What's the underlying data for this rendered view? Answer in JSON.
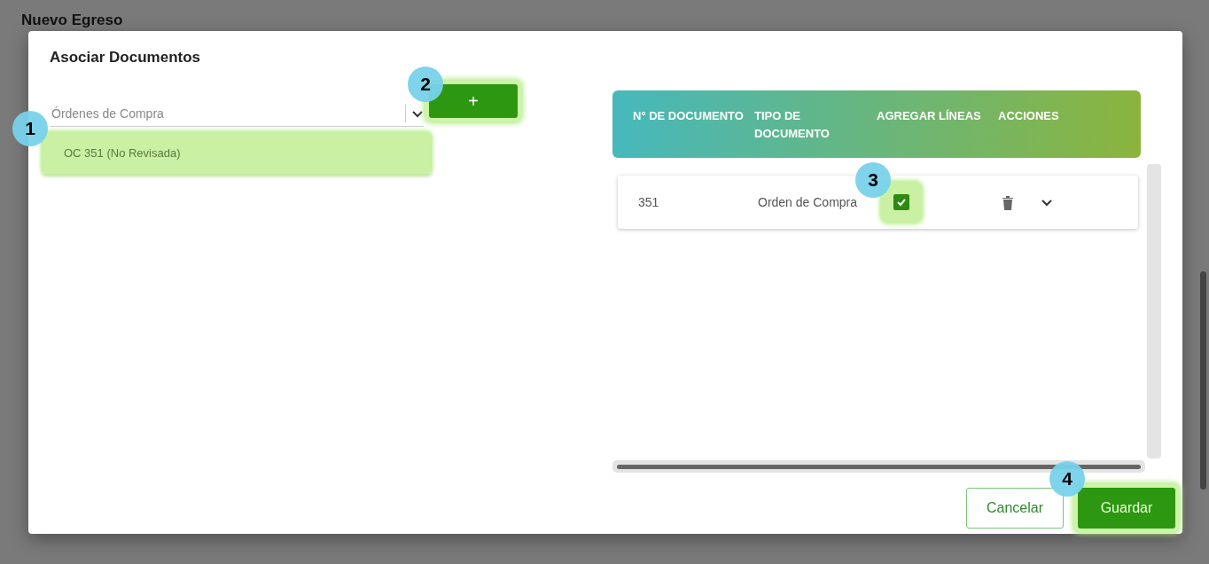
{
  "page": {
    "title": "Nuevo Egreso"
  },
  "dialog": {
    "title": "Asociar Documentos",
    "select": {
      "placeholder": "Órdenes de Compra",
      "options": [
        {
          "label": "OC 351 (No Revisada)",
          "highlighted": true
        }
      ]
    },
    "add_button": {
      "label": "+",
      "highlighted": true
    },
    "table": {
      "columns": [
        "N° DE DOCUMENTO",
        "TIPO DE DOCUMENTO",
        "AGREGAR LÍNEAS",
        "ACCIONES"
      ],
      "rows": [
        {
          "number": "351",
          "type": "Orden de Compra",
          "add_lines": true,
          "highlighted": true
        }
      ]
    },
    "buttons": [
      {
        "label": "Cancelar",
        "kind": "outline",
        "highlighted": false
      },
      {
        "label": "Guardar",
        "kind": "filled",
        "highlighted": true
      }
    ]
  },
  "callouts": [
    "1",
    "2",
    "3",
    "4"
  ]
}
